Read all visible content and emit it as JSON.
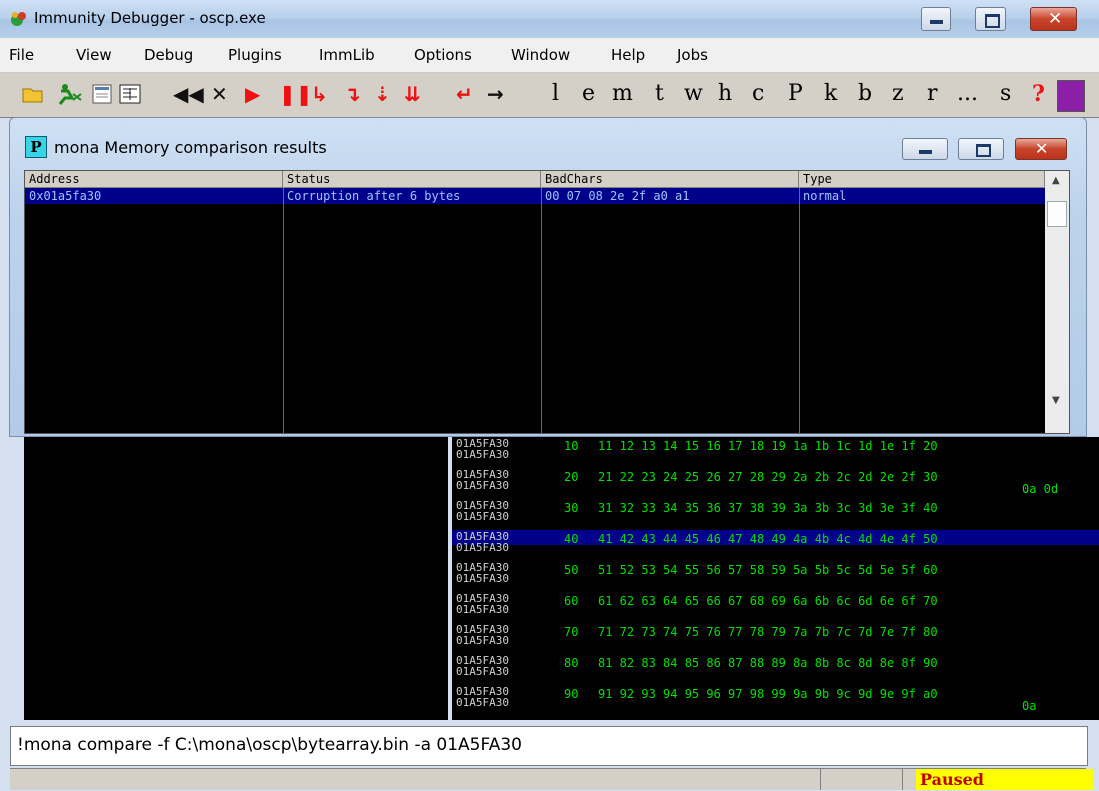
{
  "window": {
    "title": "Immunity Debugger - oscp.exe"
  },
  "menu": [
    "File",
    "View",
    "Debug",
    "Plugins",
    "ImmLib",
    "Options",
    "Window",
    "Help",
    "Jobs"
  ],
  "toolbar": {
    "letters": [
      "l",
      "e",
      "m",
      "t",
      "w",
      "h",
      "c",
      "P",
      "k",
      "b",
      "z",
      "r",
      "...",
      "s",
      "?"
    ]
  },
  "mona": {
    "icon_letter": "P",
    "title": "mona Memory comparison results",
    "columns": [
      "Address",
      "Status",
      "BadChars",
      "Type"
    ],
    "rows": [
      {
        "address": "0x01a5fa30",
        "status": "Corruption after 6 bytes",
        "badchars": "00 07 08 2e 2f a0 a1",
        "type": "normal"
      }
    ]
  },
  "dump": {
    "address": "01A5FA30",
    "rows": [
      {
        "v": "10",
        "h": "11 12 13 14 15 16 17 18 19 1a 1b 1c 1d 1e 1f 20",
        "e": ""
      },
      {
        "v": "20",
        "h": "21 22 23 24 25 26 27 28 29 2a 2b 2c 2d 2e 2f 30",
        "e": "0a 0d"
      },
      {
        "v": "30",
        "h": "31 32 33 34 35 36 37 38 39 3a 3b 3c 3d 3e 3f 40",
        "e": ""
      },
      {
        "v": "40",
        "h": "41 42 43 44 45 46 47 48 49 4a 4b 4c 4d 4e 4f 50",
        "e": ""
      },
      {
        "v": "50",
        "h": "51 52 53 54 55 56 57 58 59 5a 5b 5c 5d 5e 5f 60",
        "e": ""
      },
      {
        "v": "60",
        "h": "61 62 63 64 65 66 67 68 69 6a 6b 6c 6d 6e 6f 70",
        "e": ""
      },
      {
        "v": "70",
        "h": "71 72 73 74 75 76 77 78 79 7a 7b 7c 7d 7e 7f 80",
        "e": ""
      },
      {
        "v": "80",
        "h": "81 82 83 84 85 86 87 88 89 8a 8b 8c 8d 8e 8f 90",
        "e": ""
      },
      {
        "v": "90",
        "h": "91 92 93 94 95 96 97 98 99 9a 9b 9c 9d 9e 9f a0",
        "e": "0a"
      }
    ],
    "selected_row": 3
  },
  "command": {
    "value": "!mona compare -f C:\\mona\\oscp\\bytearray.bin -a 01A5FA30"
  },
  "status": {
    "text": "Paused"
  }
}
